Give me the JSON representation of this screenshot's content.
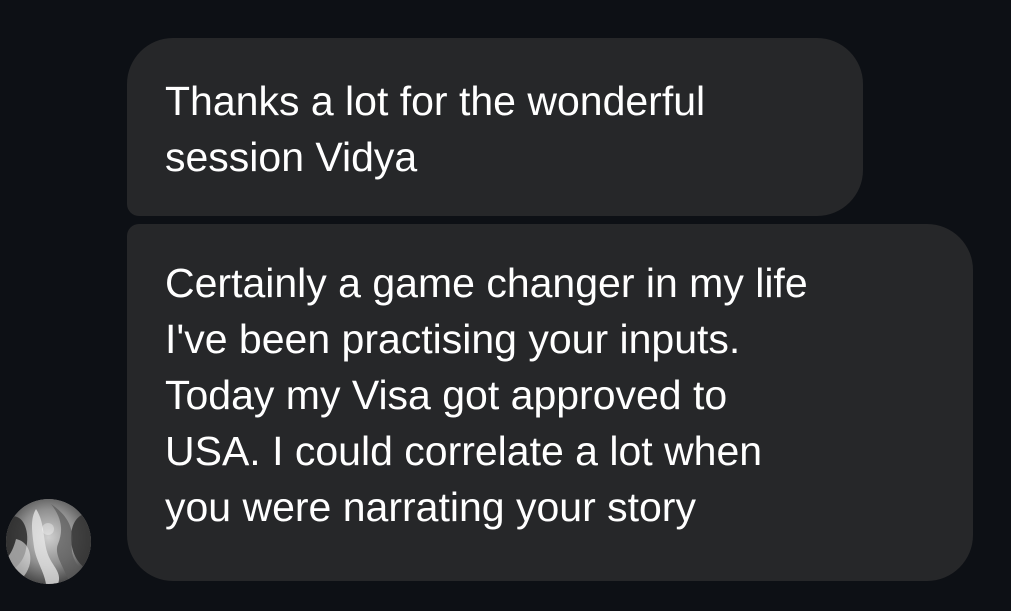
{
  "messages": [
    {
      "sender": "them",
      "text": "Thanks a lot for the wonderful\nsession Vidya"
    },
    {
      "sender": "them",
      "text": "Certainly a game changer in my life\nI've been practising your inputs.\nToday my Visa got approved to\nUSA. I could correlate a lot when\nyou were narrating your story"
    }
  ],
  "avatar": {
    "icon": "profile-photo-icon"
  },
  "colors": {
    "background": "#0d1015",
    "bubble": "#262729",
    "text": "#ffffff"
  }
}
